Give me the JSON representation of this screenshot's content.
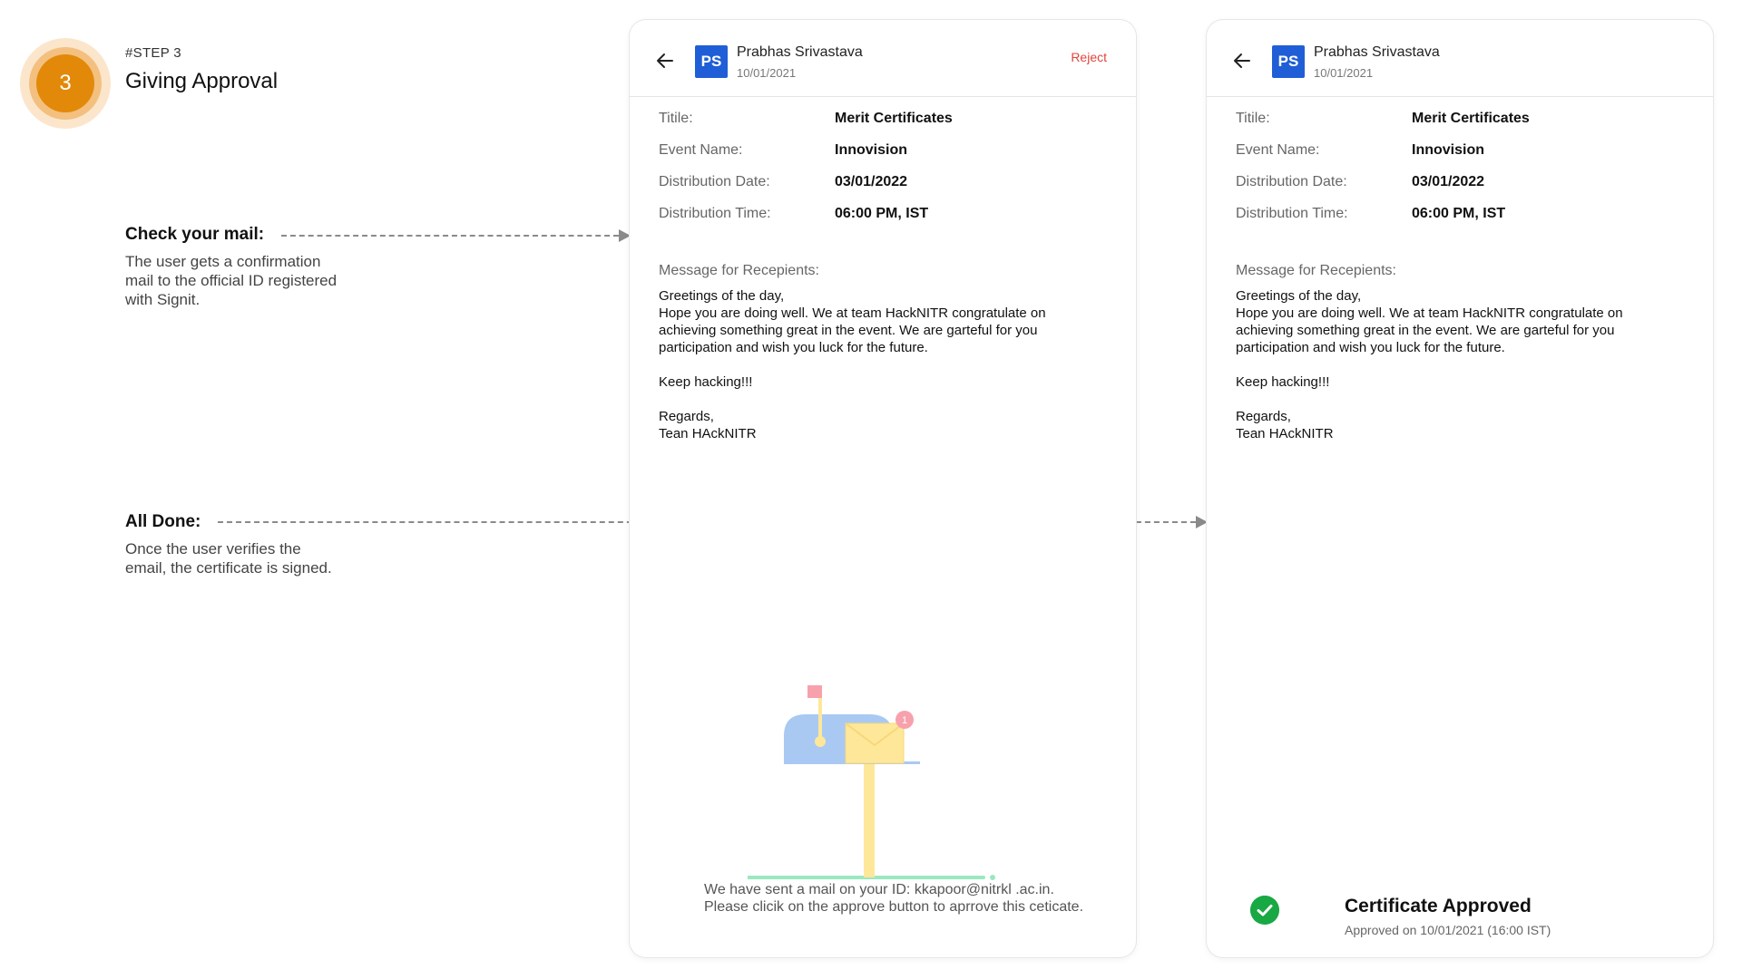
{
  "step": {
    "number": "3",
    "tag": "#STEP 3",
    "title": "Giving Approval"
  },
  "notes": {
    "check_mail": {
      "heading": "Check your mail:",
      "body": "The user gets a confirmation mail to the official ID registered with Signit."
    },
    "all_done": {
      "heading": "All Done:",
      "body": "Once the user verifies the email, the certificate is signed."
    }
  },
  "card_common": {
    "initials": "PS",
    "name": "Prabhas Srivastava",
    "date": "10/01/2021",
    "fields": [
      {
        "label": "Titile:",
        "value": "Merit Certificates"
      },
      {
        "label": "Event Name:",
        "value": "Innovision"
      },
      {
        "label": "Distribution Date:",
        "value": "03/01/2022"
      },
      {
        "label": "Distribution Time:",
        "value": "06:00 PM, IST"
      }
    ],
    "message_label": "Message for Recepients:",
    "message_lines": {
      "l1": "Greetings of the day,",
      "l2": "Hope you are doing well. We at team HackNITR congratulate on",
      "l3": "achieving something great in the event. We are garteful for you",
      "l4": "participation and wish you luck for the future.",
      "l5": "Keep hacking!!!",
      "l6": "Regards,",
      "l7": "Tean HAckNITR"
    }
  },
  "card_left": {
    "reject_label": "Reject",
    "mailbox_badge": "1",
    "mail_note": "We have sent a mail on your ID: kkapoor@nitrkl .ac.in. Please clicik on the approve button to aprrove this ceticate."
  },
  "card_right": {
    "status_title": "Certificate Approved",
    "status_sub": "Approved on 10/01/2021 (16:00 IST)"
  },
  "colors": {
    "accent_orange": "#e2890a",
    "avatar_blue": "#1f5ed7",
    "reject_red": "#e0453c",
    "approved_green": "#18a944"
  }
}
